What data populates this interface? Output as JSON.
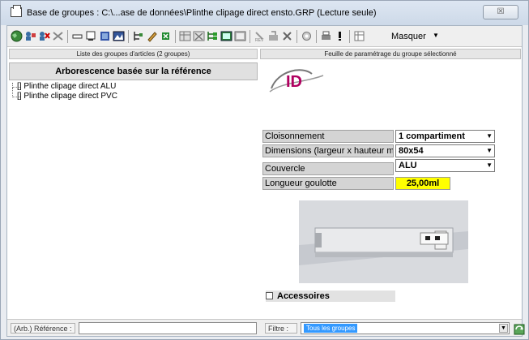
{
  "window": {
    "title": "Base de groupes : C:\\...ase de données\\Plinthe clipage direct ensto.GRP (Lecture seule)",
    "close_label": "☒"
  },
  "toolbar": {
    "masquer_label": "Masquer"
  },
  "left": {
    "header": "Liste des groupes d'articles (2 groupes)",
    "subheader": "Arborescence basée sur la référence",
    "tree": [
      {
        "label": "[] Plinthe clipage direct ALU"
      },
      {
        "label": "[] Plinthe clipage direct PVC"
      }
    ]
  },
  "right": {
    "header": "Feuille de paramétrage du groupe sélectionné",
    "params": [
      {
        "label": "Cloisonnement",
        "value": "1 compartiment"
      },
      {
        "label": "Dimensions (largeur x hauteur mm)",
        "value": "80x54"
      },
      {
        "label": "Couvercle",
        "value": "ALU"
      },
      {
        "label": "Longueur goulotte",
        "value": "25,00ml"
      }
    ],
    "accessoires_label": "Accessoires"
  },
  "bottom": {
    "ref_label": "(Arb.) Référence :",
    "filter_label": "Filtre :",
    "filter_value": "Tous les groupes"
  },
  "colors": {
    "highlight_yellow": "#ffff00",
    "selection_blue": "#3399ff"
  }
}
